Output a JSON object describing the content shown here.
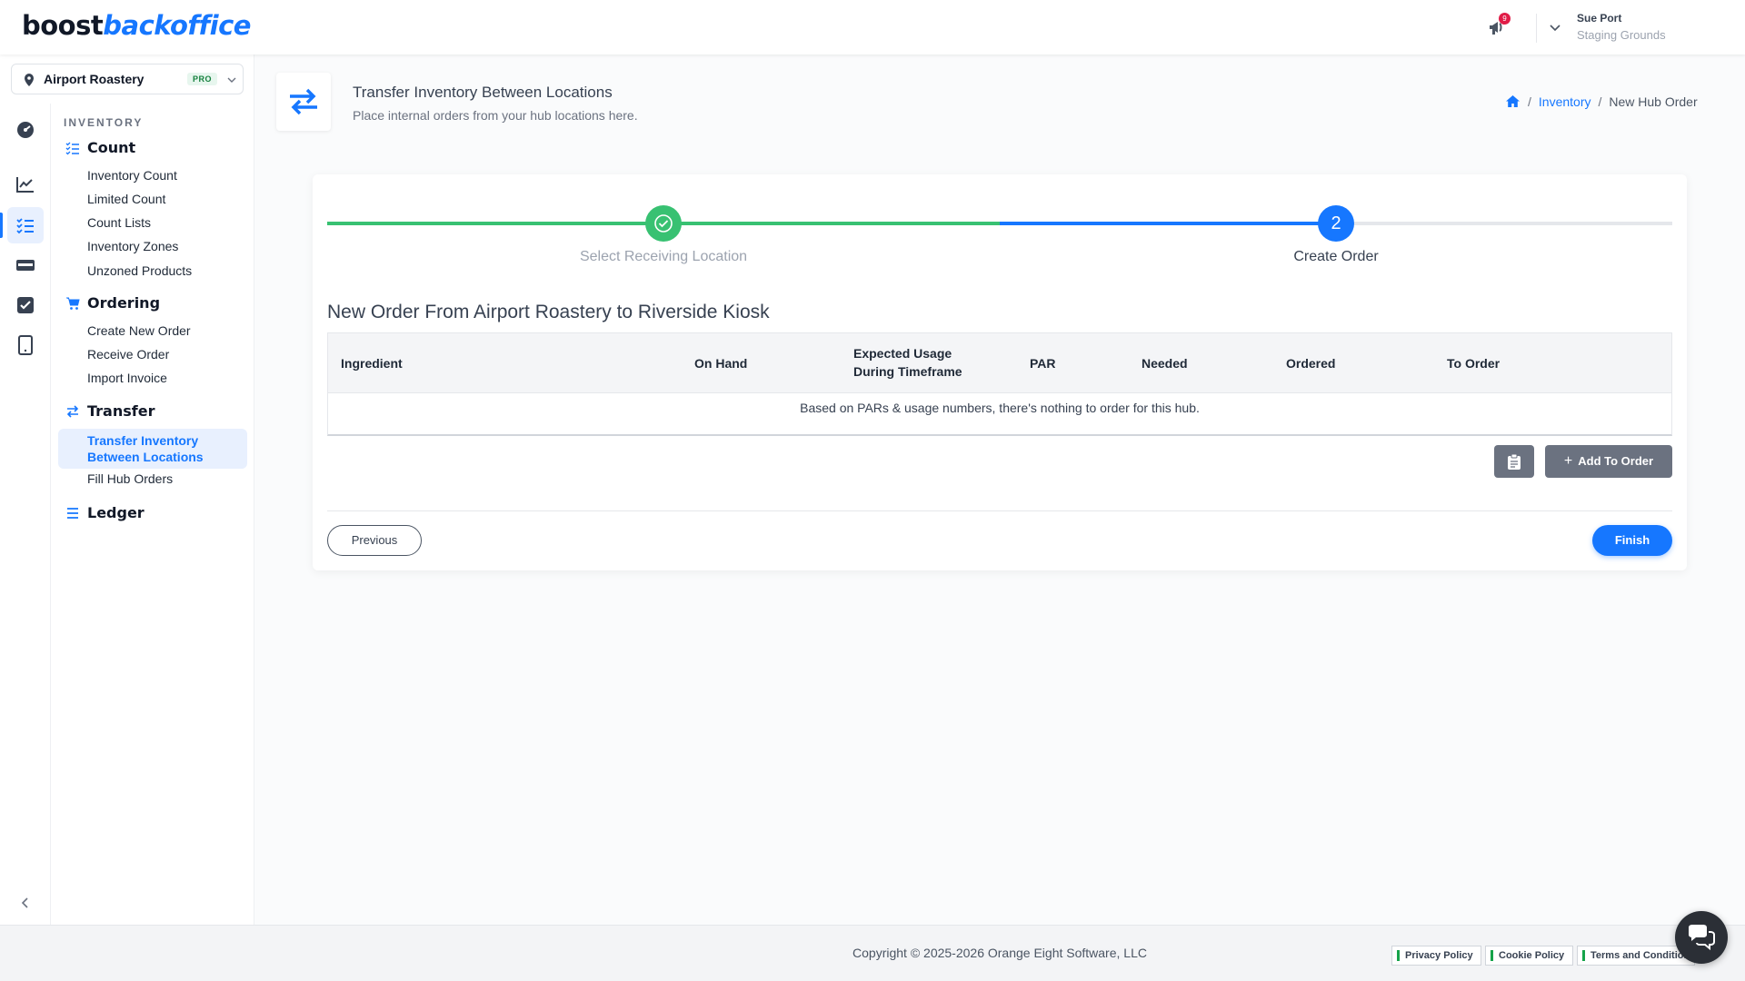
{
  "brand": {
    "part1": "boost",
    "part2": "backoffice"
  },
  "header": {
    "notification_count": "9",
    "user_name": "Sue Port",
    "user_org": "Staging Grounds"
  },
  "location_selector": {
    "name": "Airport Roastery",
    "badge": "PRO"
  },
  "sidebar": {
    "heading": "INVENTORY",
    "sections": {
      "count": {
        "label": "Count",
        "items": [
          "Inventory Count",
          "Limited Count",
          "Count Lists",
          "Inventory Zones",
          "Unzoned Products"
        ]
      },
      "ordering": {
        "label": "Ordering",
        "items": [
          "Create New Order",
          "Receive Order",
          "Import Invoice"
        ]
      },
      "transfer": {
        "label": "Transfer",
        "items": [
          "Transfer Inventory Between Locations",
          "Fill Hub Orders"
        ]
      },
      "ledger": {
        "label": "Ledger"
      }
    },
    "icons": [
      "dashboard-icon",
      "analytics-icon",
      "inventory-icon",
      "cards-icon",
      "checklist-icon",
      "tablet-icon"
    ]
  },
  "page": {
    "title": "Transfer Inventory Between Locations",
    "subtitle": "Place internal orders from your hub locations here."
  },
  "breadcrumb": {
    "link": "Inventory",
    "current": "New Hub Order"
  },
  "stepper": {
    "step1_label": "Select Receiving Location",
    "step2_number": "2",
    "step2_label": "Create Order"
  },
  "order": {
    "title": "New Order From Airport Roastery to Riverside Kiosk",
    "columns": [
      "Ingredient",
      "On Hand",
      "Expected Usage\nDuring Timeframe",
      "PAR",
      "Needed",
      "Ordered",
      "To Order"
    ],
    "empty_message": "Based on PARs & usage numbers, there's nothing to order for this hub."
  },
  "buttons": {
    "add_to_order": "Add To Order",
    "previous": "Previous",
    "finish": "Finish"
  },
  "footer": {
    "copyright": "Copyright © 2025-2026 Orange Eight Software, LLC",
    "links": [
      "Privacy Policy",
      "Cookie Policy",
      "Terms and Conditions"
    ]
  },
  "colors": {
    "accent": "#1677ff",
    "success": "#38c172",
    "badge_red": "#e11d48"
  }
}
